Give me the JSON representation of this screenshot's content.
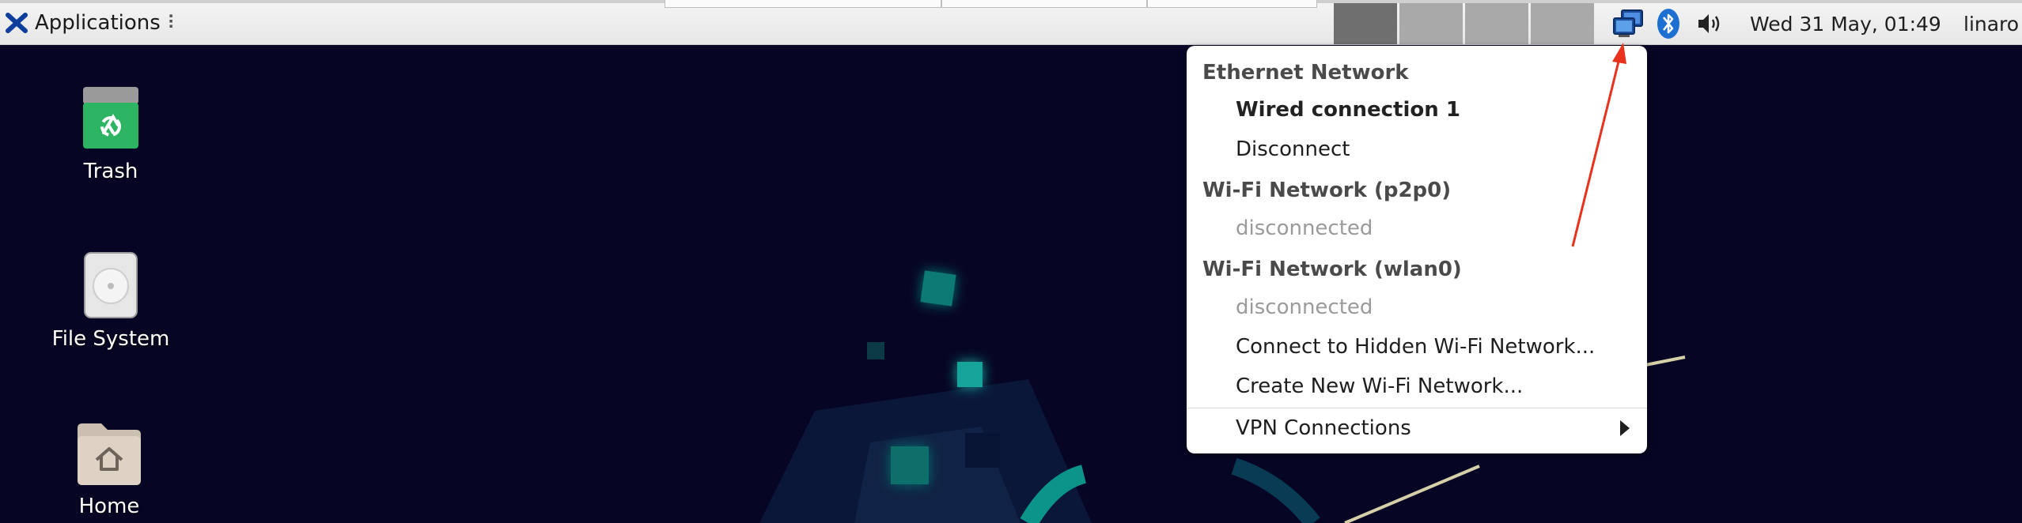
{
  "panel": {
    "applications_label": "Applications",
    "clock": "Wed 31 May, 01:49",
    "user": "linaro"
  },
  "desktop_icons": [
    {
      "label": "Trash"
    },
    {
      "label": "File System"
    },
    {
      "label": "Home"
    }
  ],
  "network_menu": {
    "ethernet_header": "Ethernet Network",
    "wired_connection": "Wired connection 1",
    "disconnect": "Disconnect",
    "wifi_p2p_header": "Wi-Fi Network (p2p0)",
    "wifi_p2p_status": "disconnected",
    "wifi_wlan_header": "Wi-Fi Network (wlan0)",
    "wifi_wlan_status": "disconnected",
    "connect_hidden": "Connect to Hidden Wi-Fi Network...",
    "create_new": "Create New Wi-Fi Network...",
    "vpn": "VPN Connections"
  },
  "colors": {
    "desktop_bg": "#060524",
    "accent_teal": "#0e9e94",
    "annotation_arrow": "#e8321e",
    "trash_green": "#2db463"
  },
  "icons": [
    "xfce-logo-icon",
    "network-icon",
    "bluetooth-icon",
    "volume-icon",
    "trash-icon",
    "drive-icon",
    "home-folder-icon"
  ]
}
